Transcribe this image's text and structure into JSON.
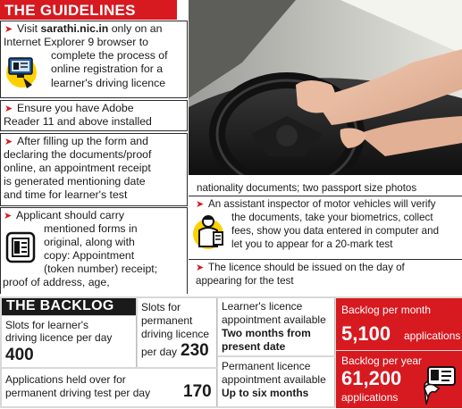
{
  "guidelines": {
    "title": "THE GUIDELINES",
    "item1": {
      "line1_pre": "Visit ",
      "site": "sarathi.nic.in",
      "line1_post": " only on an",
      "line2": "Internet Explorer 9 browser to",
      "line3": "complete the process of",
      "line4": "online registration for a",
      "line5": "learner's driving licence"
    },
    "item2": {
      "line1": "Ensure you have Adobe",
      "line2": "Reader 11 and above installed"
    },
    "item3": {
      "line1": "After filling up the form and",
      "line2": "declaring the documents/proof",
      "line3": "online, an appointment receipt",
      "line4": "is generated mentioning date",
      "line5": "and time for learner's test"
    },
    "item4": {
      "line1": "Applicant should carry",
      "line2": "mentioned forms in",
      "line3": "original, along with",
      "line4": "copy: Appointment",
      "line5": "(token number) receipt;",
      "line6": "proof of address, age,"
    },
    "cont_line": "nationality documents; two passport size photos",
    "item5": {
      "line1": "An assistant inspector of motor vehicles will verify",
      "line2": "the documents, take your biometrics, collect",
      "line3": "fees, show you data entered in computer and",
      "line4": "let you to appear for a 20-mark test"
    },
    "item6": {
      "line1": "The licence should be issued on the day of",
      "line2": "appearing for the test"
    }
  },
  "backlog": {
    "title": "THE BACKLOG",
    "slots_learner": {
      "line1": "Slots for learner's",
      "line2": "driving licence per day",
      "value": "400"
    },
    "slots_permanent": {
      "line1": "Slots for",
      "line2": "permanent",
      "line3": "driving licence",
      "line4": "per day",
      "value": "230"
    },
    "held_over": {
      "line1": "Applications held over for",
      "line2": "permanent driving test per day",
      "value": "170"
    },
    "learner_appt": {
      "line1": "Learner's licence",
      "line2": "appointment available",
      "bold1": "Two months from",
      "bold2": "present date"
    },
    "permanent_appt": {
      "line1": "Permanent licence",
      "line2": "appointment available",
      "bold": "Up to six months"
    },
    "per_month": {
      "label": "Backlog per month",
      "value": "5,100",
      "unit": "applications"
    },
    "per_year": {
      "label": "Backlog per year",
      "value": "61,200",
      "unit": "applications"
    }
  },
  "colors": {
    "accent": "#d71920",
    "dark": "#1a1a1a"
  },
  "icons": [
    "computer-form-icon",
    "document-icon",
    "inspector-icon",
    "license-card-icon"
  ]
}
